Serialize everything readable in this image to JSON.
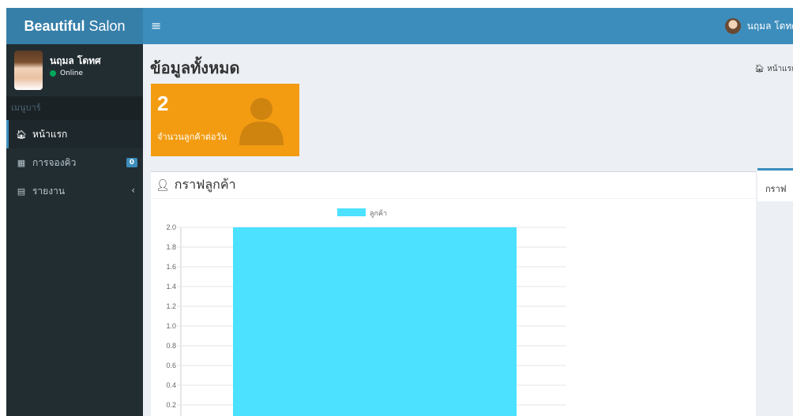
{
  "header": {
    "logo_bold": "Beautiful",
    "logo_rest": " Salon",
    "toggle_icon": "≡",
    "user_name": "นฤมล โดทศ"
  },
  "sidebar": {
    "user": {
      "name": "นฤมล โดทศ",
      "status": "Online"
    },
    "menu_header": "เมนูบาร์",
    "items": [
      {
        "label": "หน้าแรก",
        "icon": "home-icon",
        "glyph": "🏠︎"
      },
      {
        "label": "การจองคิว",
        "icon": "calendar-icon",
        "glyph": "▦",
        "badge": "0"
      },
      {
        "label": "รายงาน",
        "icon": "file-icon",
        "glyph": "▤",
        "chevron": "‹"
      }
    ]
  },
  "content": {
    "title": "ข้อมูลทั้งหมด",
    "breadcrumb": "🏠︎ หน้าแรก",
    "stat": {
      "value": "2",
      "label": "จำนวนลูกค้าต่อวัน"
    },
    "chart_title": "กราฟลูกค้า",
    "chart_icon": "user-icon",
    "tab_label": "กราฟ"
  },
  "chart_data": {
    "type": "bar",
    "categories": [
      ""
    ],
    "series": [
      {
        "name": "ลูกค้า",
        "values": [
          2
        ],
        "color": "#4be1ff"
      }
    ],
    "yticks": [
      "2.0",
      "1.8",
      "1.6",
      "1.4",
      "1.2",
      "1.0",
      "0.8",
      "0.6",
      "0.4",
      "0.2"
    ],
    "ylim": [
      0,
      2
    ],
    "grid": true,
    "legend": "top"
  }
}
